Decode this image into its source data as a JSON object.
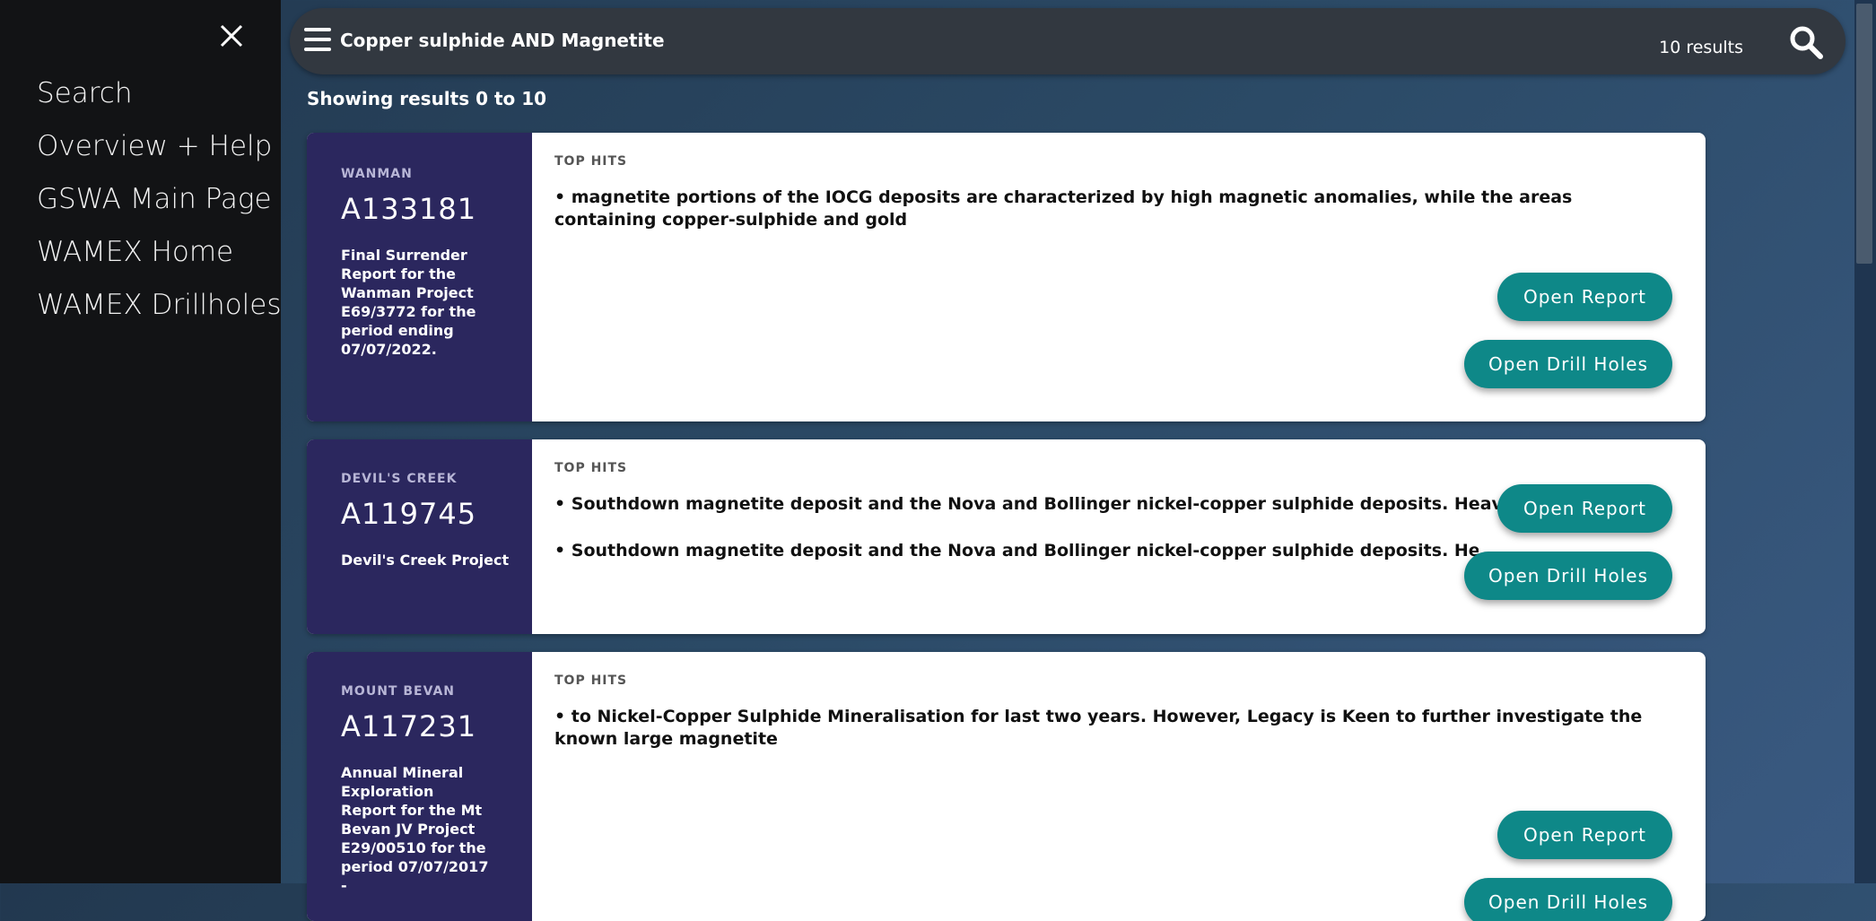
{
  "sidebar": {
    "close_icon": "close-icon",
    "items": [
      {
        "label": "Search"
      },
      {
        "label": "Overview + Help"
      },
      {
        "label": "GSWA Main Page"
      },
      {
        "label": "WAMEX Home"
      },
      {
        "label": "WAMEX Drillholes"
      }
    ]
  },
  "topbar": {
    "menu_icon": "hamburger-icon",
    "query": "Copper sulphide AND Magnetite",
    "count": "10 results",
    "search_icon": "search-icon"
  },
  "showing": "Showing results 0 to 10",
  "results": [
    {
      "area": "WANMAN",
      "id": "A133181",
      "description": "Final Surrender Report for the Wanman Project E69/3772 for the period ending 07/07/2022.",
      "top_hits_label": "TOP HITS",
      "hits": [
        "• magnetite portions of the IOCG deposits are characterized by high magnetic anomalies, while the areas containing copper-sulphide and gold"
      ],
      "open_report_label": "Open Report",
      "open_drill_label": "Open Drill Holes"
    },
    {
      "area": "DEVIL'S CREEK",
      "id": "A119745",
      "description": "Devil's Creek Project",
      "top_hits_label": "TOP HITS",
      "hits": [
        "• Southdown magnetite deposit and the Nova and Bollinger nickel-copper sulphide deposits. Heavy mineral",
        "• Southdown magnetite deposit and the Nova and Bollinger nickel-copper sulphide deposits. Heavy mine"
      ],
      "open_report_label": "Open Report",
      "open_drill_label": "Open Drill Holes"
    },
    {
      "area": "MOUNT BEVAN",
      "id": "A117231",
      "description": "Annual Mineral Exploration Report for the Mt Bevan JV Project E29/00510 for the period 07/07/2017 -",
      "top_hits_label": "TOP HITS",
      "hits": [
        "• to Nickel-Copper Sulphide Mineralisation for last two years. However, Legacy is Keen to further investigate the known large magnetite"
      ],
      "open_report_label": "Open Report",
      "open_drill_label": "Open Drill Holes"
    }
  ]
}
